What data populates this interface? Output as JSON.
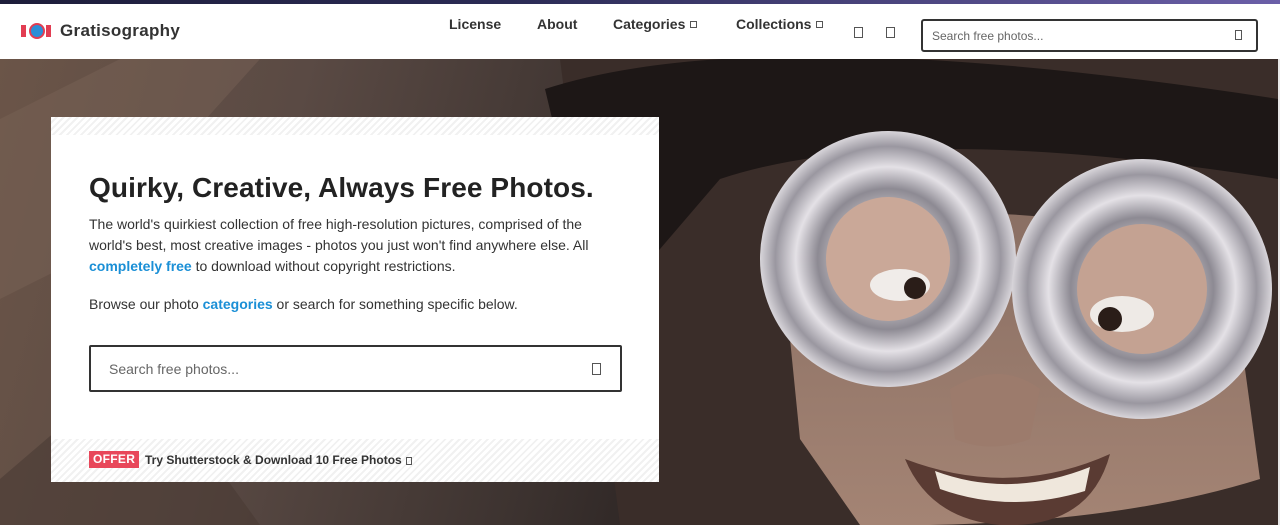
{
  "brand": {
    "name": "Gratisography",
    "logo_colors": {
      "red": "#e23d52",
      "blue": "#2c8ed6"
    }
  },
  "nav": {
    "items": [
      {
        "label": "License"
      },
      {
        "label": "About"
      },
      {
        "label": "Categories",
        "has_dropdown": true
      },
      {
        "label": "Collections",
        "has_dropdown": true
      }
    ],
    "icons": [
      "heart-icon",
      "user-icon"
    ]
  },
  "header_search": {
    "placeholder": "Search free photos...",
    "value": ""
  },
  "hero": {
    "title": "Quirky, Creative, Always Free Photos.",
    "desc_1": "The world's quirkiest collection of free high-resolution pictures, comprised of the world's best, most creative images - photos you just won't find anywhere else. All ",
    "desc_link": "completely free",
    "desc_2": " to download without copyright restrictions.",
    "browse_1": "Browse our photo ",
    "browse_link": "categories",
    "browse_2": " or search for something specific below.",
    "search": {
      "placeholder": "Search free photos...",
      "value": ""
    },
    "offer": {
      "badge": "OFFER",
      "text": "Try Shutterstock & Download 10 Free Photos"
    }
  },
  "colors": {
    "accent_link": "#1a8fd6",
    "offer_badge": "#e8475a",
    "text_dark": "#222222"
  }
}
